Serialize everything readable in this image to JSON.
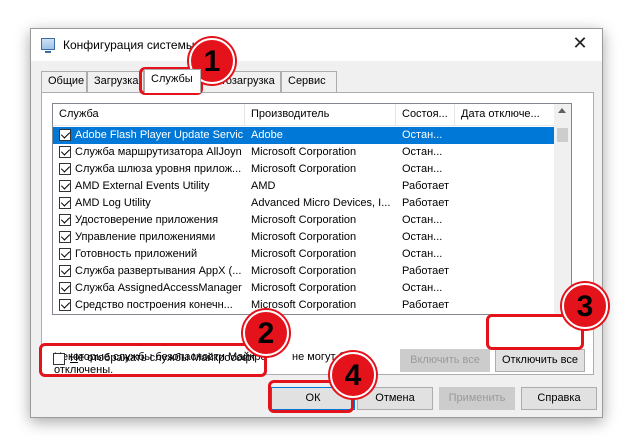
{
  "window": {
    "title": "Конфигурация системы",
    "close_glyph": "✕"
  },
  "tabs": [
    "Общие",
    "Загрузка",
    "Службы",
    "Автозагрузка",
    "Сервис"
  ],
  "columns": [
    "Служба",
    "Производитель",
    "Состоя...",
    "Дата отключе..."
  ],
  "rows": [
    {
      "name": "Adobe Flash Player Update Service",
      "vendor": "Adobe",
      "status": "Остан..."
    },
    {
      "name": "Служба маршрутизатора AllJoyn",
      "vendor": "Microsoft Corporation",
      "status": "Остан..."
    },
    {
      "name": "Служба шлюза уровня прилож...",
      "vendor": "Microsoft Corporation",
      "status": "Остан..."
    },
    {
      "name": "AMD External Events Utility",
      "vendor": "AMD",
      "status": "Работает"
    },
    {
      "name": "AMD Log Utility",
      "vendor": "Advanced Micro Devices, I...",
      "status": "Работает"
    },
    {
      "name": "Удостоверение приложения",
      "vendor": "Microsoft Corporation",
      "status": "Остан..."
    },
    {
      "name": "Управление приложениями",
      "vendor": "Microsoft Corporation",
      "status": "Остан..."
    },
    {
      "name": "Готовность приложений",
      "vendor": "Microsoft Corporation",
      "status": "Остан..."
    },
    {
      "name": "Служба развертывания AppX (...",
      "vendor": "Microsoft Corporation",
      "status": "Работает"
    },
    {
      "name": "Служба AssignedAccessManager",
      "vendor": "Microsoft Corporation",
      "status": "Остан..."
    },
    {
      "name": "Средство построения конечн...",
      "vendor": "Microsoft Corporation",
      "status": "Работает"
    }
  ],
  "note_left": "Некоторые службы безопасности Майкро",
  "note_right": "не могут быть",
  "note_line2": "отключены.",
  "enable_all": "Включить все",
  "disable_all": "Отключить все",
  "hide_ms_prefix": "Н",
  "hide_ms_rest": "е отображать службы Майкрософт",
  "ok": "ОК",
  "cancel": "Отмена",
  "apply": "Применить",
  "help": "Справка",
  "badges": [
    "1",
    "2",
    "3",
    "4"
  ],
  "colors": {
    "accent": "#0078d7",
    "callout": "#e3121b"
  }
}
